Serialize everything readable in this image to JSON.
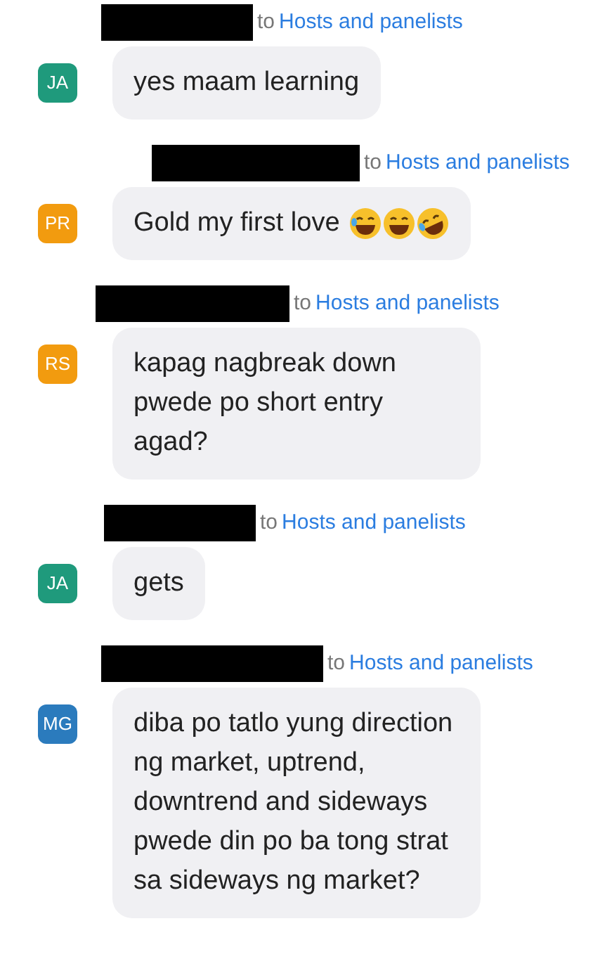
{
  "messages": [
    {
      "to": "to",
      "recipient": "Hosts and panelists",
      "initials": "JA",
      "color": "#1f9a7c",
      "text": "yes maam learning"
    },
    {
      "to": "to",
      "recipient": "Hosts and panelists",
      "initials": "PR",
      "color": "#f29b0f",
      "text": "Gold my first love",
      "emojis": [
        {
          "kind": "tears"
        },
        {
          "kind": "grin"
        },
        {
          "kind": "rofl"
        }
      ]
    },
    {
      "to": "to",
      "recipient": "Hosts and panelists",
      "initials": "RS",
      "color": "#f29b0f",
      "text": "kapag nagbreak down pwede po short entry agad?"
    },
    {
      "to": "to",
      "recipient": "Hosts and panelists",
      "initials": "JA",
      "color": "#1f9a7c",
      "text": "gets"
    },
    {
      "to": "to",
      "recipient": "Hosts and panelists",
      "initials": "MG",
      "color": "#2b7bbd",
      "text": "diba po tatlo yung direction ng market, uptrend, downtrend and sideways pwede din po ba tong strat sa sideways ng market?"
    }
  ]
}
